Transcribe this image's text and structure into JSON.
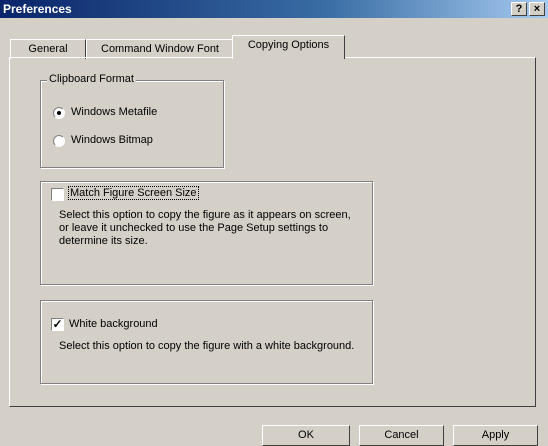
{
  "window": {
    "title": "Preferences",
    "help_label": "?",
    "close_label": "×"
  },
  "tabs": [
    {
      "label": "General"
    },
    {
      "label": "Command Window Font"
    },
    {
      "label": "Copying Options"
    }
  ],
  "active_tab": "Copying Options",
  "clipboard_format": {
    "legend": "Clipboard Format",
    "options": [
      {
        "label": "Windows Metafile",
        "selected": true
      },
      {
        "label": "Windows Bitmap",
        "selected": false
      }
    ]
  },
  "match_figure": {
    "label": "Match Figure Screen Size",
    "checked": false,
    "description": "Select this option to copy the figure as it appears on screen, or leave it unchecked to use the Page Setup settings to determine its size."
  },
  "white_background": {
    "label": "White background",
    "checked": true,
    "check_glyph": "✓",
    "description": "Select this option to copy the figure with a white background."
  },
  "buttons": {
    "ok": "OK",
    "cancel": "Cancel",
    "apply": "Apply"
  }
}
